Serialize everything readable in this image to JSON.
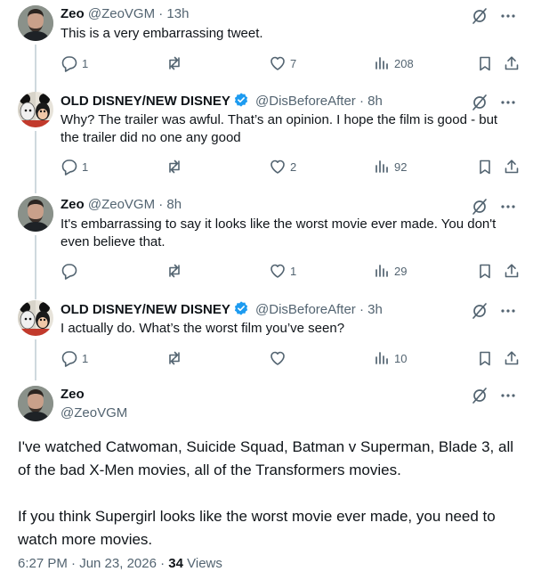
{
  "replies": [
    {
      "name": "Zeo",
      "handle": "@ZeoVGM",
      "time": "· 13h",
      "text": "This is a very embarrassing tweet.",
      "replies": "1",
      "reposts": "",
      "likes": "7",
      "views": "208"
    },
    {
      "name": "OLD DISNEY/NEW DISNEY",
      "handle": "@DisBeforeAfter",
      "time": "· 8h",
      "text": "Why? The trailer was awful. That’s an opinion. I hope the film is good - but the trailer did no one any good",
      "replies": "1",
      "reposts": "",
      "likes": "2",
      "views": "92"
    },
    {
      "name": "Zeo",
      "handle": "@ZeoVGM",
      "time": "· 8h",
      "text": "It's embarrassing to say it looks like the worst movie ever made. You don't even believe that.",
      "replies": "",
      "reposts": "",
      "likes": "1",
      "views": "29"
    },
    {
      "name": "OLD DISNEY/NEW DISNEY",
      "handle": "@DisBeforeAfter",
      "time": "· 3h",
      "text": "I actually do. What’s the worst film you’ve seen?",
      "replies": "1",
      "reposts": "",
      "likes": "",
      "views": "10"
    }
  ],
  "main": {
    "name": "Zeo",
    "handle": "@ZeoVGM",
    "paragraph1": "I've watched Catwoman, Suicide Squad, Batman v Superman, Blade 3, all of the bad X-Men movies, all of the Transformers movies.",
    "paragraph2": "If you think Supergirl looks like the worst movie ever made, you need to watch more movies.",
    "timestamp": "6:27 PM · Jun 23, 2026 ·",
    "views_count": "34",
    "views_label": "Views"
  },
  "colors": {
    "verified": "#1d9bf0",
    "muted": "#536471",
    "thread_line": "#cfd9de"
  },
  "icons": [
    "reply-icon",
    "repost-icon",
    "like-icon",
    "views-icon",
    "bookmark-icon",
    "share-icon",
    "grok-icon",
    "more-icon",
    "verified-badge-icon"
  ]
}
